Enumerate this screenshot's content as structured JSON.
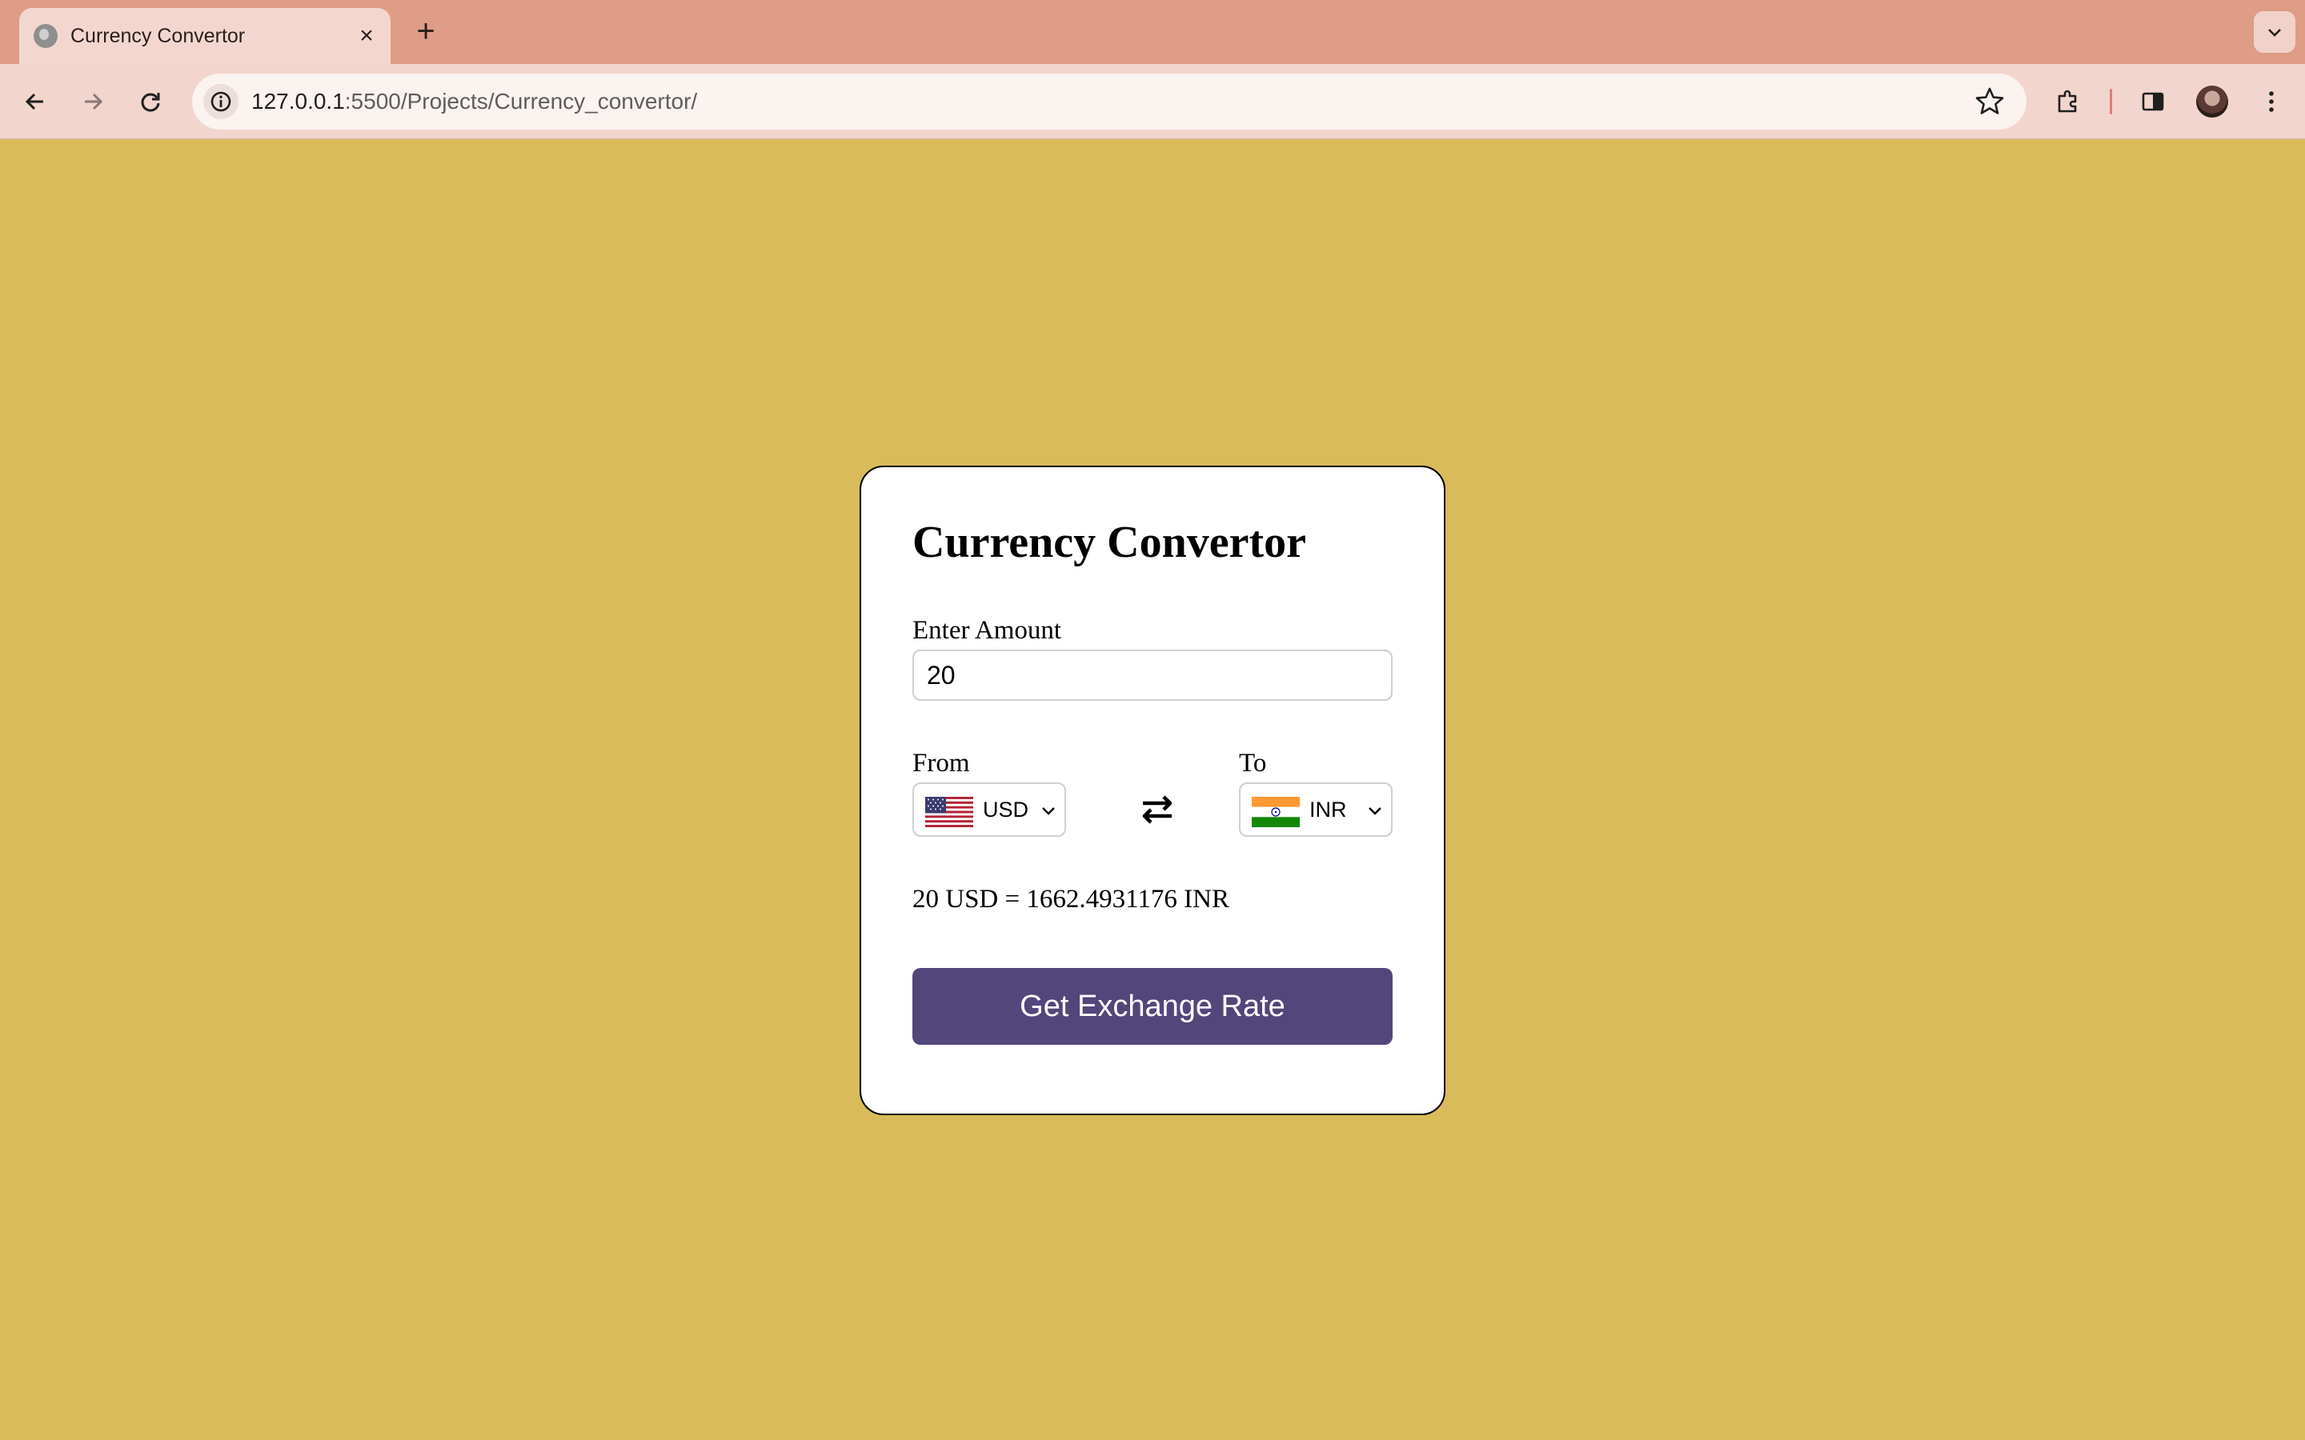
{
  "browser": {
    "tab_title": "Currency Convertor",
    "url_host": "127.0.0.1",
    "url_rest": ":5500/Projects/Currency_convertor/"
  },
  "app": {
    "title": "Currency Convertor",
    "amount_label": "Enter Amount",
    "amount_value": "20",
    "from_label": "From",
    "from_currency": "USD",
    "to_label": "To",
    "to_currency": "INR",
    "result_text": "20 USD = 1662.4931176 INR",
    "button_label": "Get Exchange Rate"
  },
  "colors": {
    "page_background": "#d9bc59",
    "button": "#52467a",
    "tab_strip": "#df9c87"
  },
  "icons": {
    "back": "arrow-left-icon",
    "forward": "arrow-right-icon",
    "reload": "reload-icon",
    "site_info": "info-icon",
    "bookmark": "star-icon",
    "extensions": "puzzle-icon",
    "side_panel": "side-panel-icon",
    "menu": "kebab-menu-icon",
    "swap": "swap-arrows-icon"
  }
}
